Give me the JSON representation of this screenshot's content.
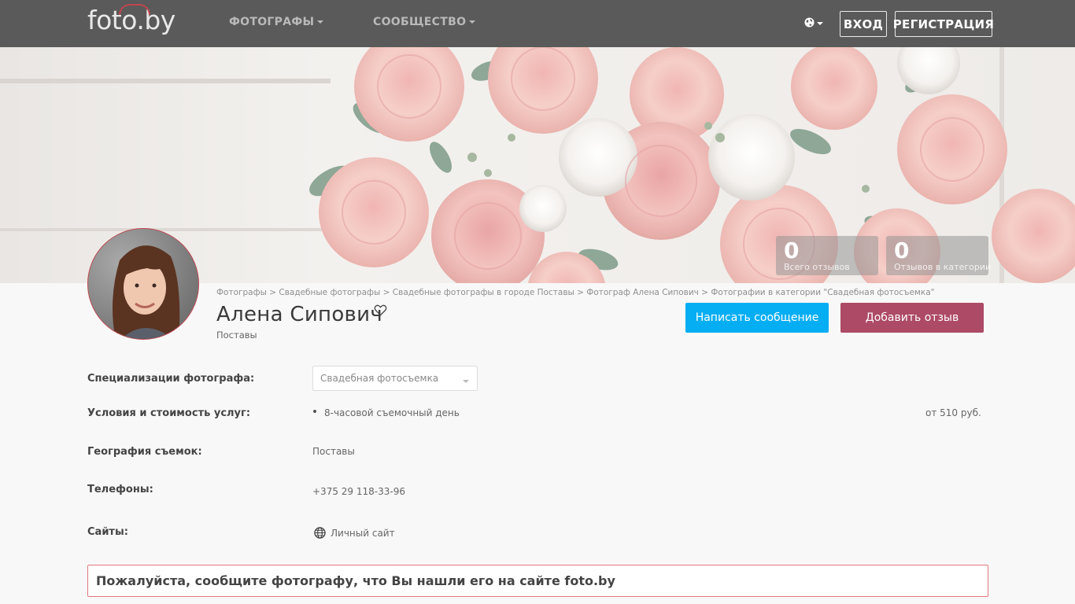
{
  "header": {
    "logo": "foto.by",
    "nav": [
      {
        "label": "ФОТОГРАФЫ"
      },
      {
        "label": "СООБЩЕСТВО"
      }
    ],
    "login_label": "ВХОД",
    "register_label": "РЕГИСТРАЦИЯ"
  },
  "stats": [
    {
      "value": "0",
      "label": "Всего отзывов"
    },
    {
      "value": "0",
      "label": "Отзывов в категории"
    }
  ],
  "breadcrumb": [
    "Фотографы",
    "Свадебные фотографы",
    "Свадебные фотографы в городе Поставы",
    "Фотограф Алена Сипович",
    "Фотографии в категории \"Свадебная фотосъемка\""
  ],
  "breadcrumb_separator": " > ",
  "profile": {
    "name": "Алена Сипович",
    "city": "Поставы",
    "message_button": "Написать сообщение",
    "review_button": "Добавить отзыв"
  },
  "info": {
    "specializations_label": "Специализации фотографа:",
    "specialization_selected": "Свадебная фотосъемка",
    "services_label": "Условия и стоимость услуг:",
    "services": [
      {
        "name": "8-часовой съемочный день",
        "price": "от 510 руб."
      }
    ],
    "geography_label": "География съемок:",
    "geography_value": "Поставы",
    "phones_label": "Телефоны:",
    "phone": "+375 29 118-33-96",
    "sites_label": "Сайты:",
    "site_link": "Личный сайт"
  },
  "notice": "Пожалуйста, сообщите фотографу, что Вы нашли его на сайте foto.by",
  "colors": {
    "header_bg": "#5a5a5a",
    "message_button": "#05aef3",
    "review_button": "#ad4a66",
    "accent": "#c0454f"
  }
}
